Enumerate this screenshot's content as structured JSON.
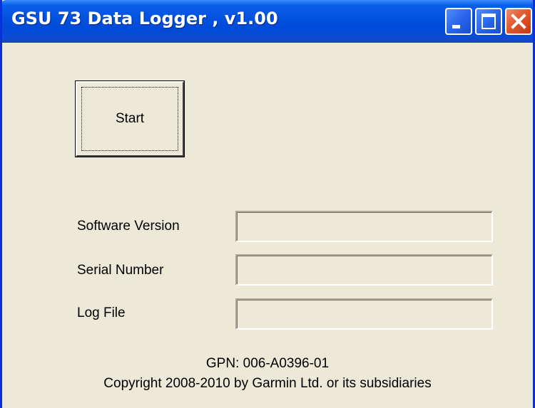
{
  "window": {
    "title": "GSU 73 Data Logger , v1.00",
    "controls": {
      "minimize_icon": "minimize-icon",
      "maximize_icon": "maximize-icon",
      "close_icon": "close-icon"
    }
  },
  "main": {
    "start_label": "Start",
    "fields": [
      {
        "label": "Software Version",
        "value": ""
      },
      {
        "label": "Serial Number",
        "value": ""
      },
      {
        "label": "Log File",
        "value": ""
      }
    ]
  },
  "footer": {
    "gpn": "GPN: 006-A0396-01",
    "copyright": "Copyright 2008-2010 by Garmin Ltd. or its subsidiaries"
  },
  "colors": {
    "titlebar": "#0253E0",
    "window_bg": "#ECE9D8",
    "close_button": "#E0542C"
  }
}
